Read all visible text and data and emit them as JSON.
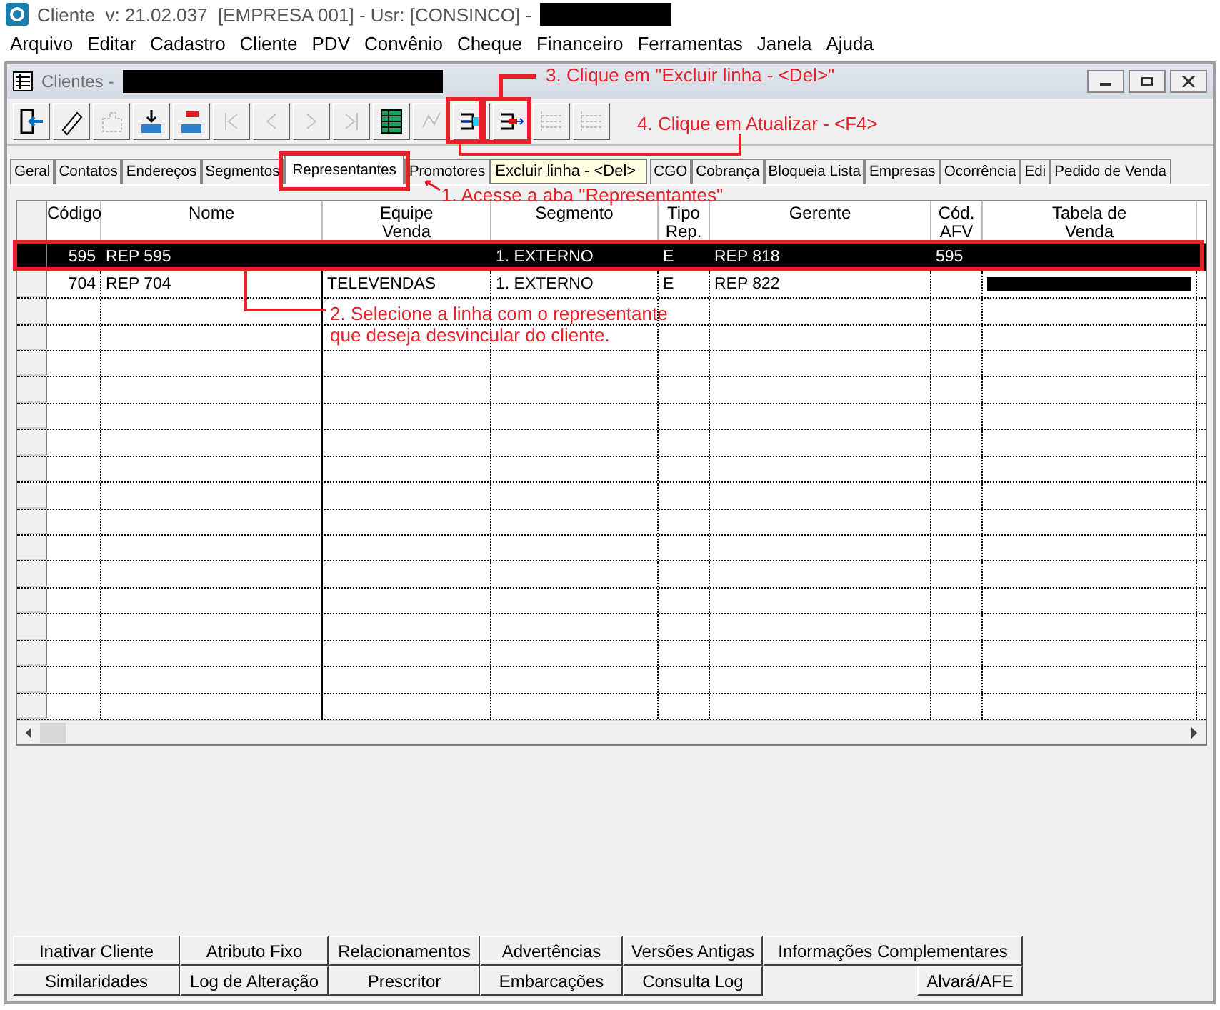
{
  "app_title": "Cliente  v: 21.02.037  [EMPRESA 001] - Usr: [CONSINCO] -",
  "menu": [
    "Arquivo",
    "Editar",
    "Cadastro",
    "Cliente",
    "PDV",
    "Convênio",
    "Cheque",
    "Financeiro",
    "Ferramentas",
    "Janela",
    "Ajuda"
  ],
  "window": {
    "title": "Clientes -"
  },
  "toolbar_buttons": [
    {
      "disabled": false
    },
    {
      "disabled": false
    },
    {
      "disabled": true
    },
    {
      "disabled": false
    },
    {
      "disabled": false
    },
    {
      "disabled": true
    },
    {
      "disabled": true
    },
    {
      "disabled": true
    },
    {
      "disabled": true
    },
    {
      "disabled": false
    },
    {
      "disabled": true
    },
    {
      "disabled": false
    },
    {
      "disabled": false
    },
    {
      "disabled": true
    },
    {
      "disabled": true
    }
  ],
  "tabs": [
    {
      "label": "Geral",
      "selected": false
    },
    {
      "label": "Contatos",
      "selected": false
    },
    {
      "label": "Endereços",
      "selected": false
    },
    {
      "label": "Segmentos",
      "selected": false
    },
    {
      "label": "Representantes",
      "selected": true
    },
    {
      "label": "Promotores",
      "selected": false
    },
    {
      "label": "CGO",
      "selected": false
    },
    {
      "label": "Cobrança",
      "selected": false
    },
    {
      "label": "Bloqueia Lista",
      "selected": false
    },
    {
      "label": "Empresas",
      "selected": false
    },
    {
      "label": "Ocorrência",
      "selected": false
    },
    {
      "label": "Edi",
      "selected": false
    },
    {
      "label": "Pedido de Venda",
      "selected": false
    }
  ],
  "tooltip": "Excluir linha - <Del>",
  "table": {
    "columns": [
      "Código",
      "Nome",
      "Equipe\nVenda",
      "Segmento",
      "Tipo\nRep.",
      "Gerente",
      "Cód.\nAFV",
      "Tabela de\nVenda"
    ],
    "rows": [
      {
        "selected": true,
        "cells": [
          "595",
          "REP 595",
          null,
          "1. EXTERNO",
          "E",
          "REP 818",
          "595",
          null
        ]
      },
      {
        "selected": false,
        "cells": [
          "704",
          "REP 704",
          "TELEVENDAS",
          "1. EXTERNO",
          "E",
          "REP 822",
          null,
          null
        ]
      }
    ]
  },
  "bottom_buttons": [
    [
      "Inativar Cliente",
      "Atributo Fixo",
      "Relacionamentos",
      "Advertências",
      "Versões Antigas",
      "Informações Complementares"
    ],
    [
      "Similaridades",
      "Log de Alteração",
      "Prescritor",
      "Embarcações",
      "Consulta Log",
      "Alvará/AFE"
    ]
  ],
  "annotations": [
    "3. Clique em \"Excluir linha - <Del>\"",
    "4. Clique em Atualizar - <F4>",
    "1. Acesse a aba \"Representantes\"",
    "2. Selecione a linha com o representante que deseja desvincular do cliente."
  ]
}
